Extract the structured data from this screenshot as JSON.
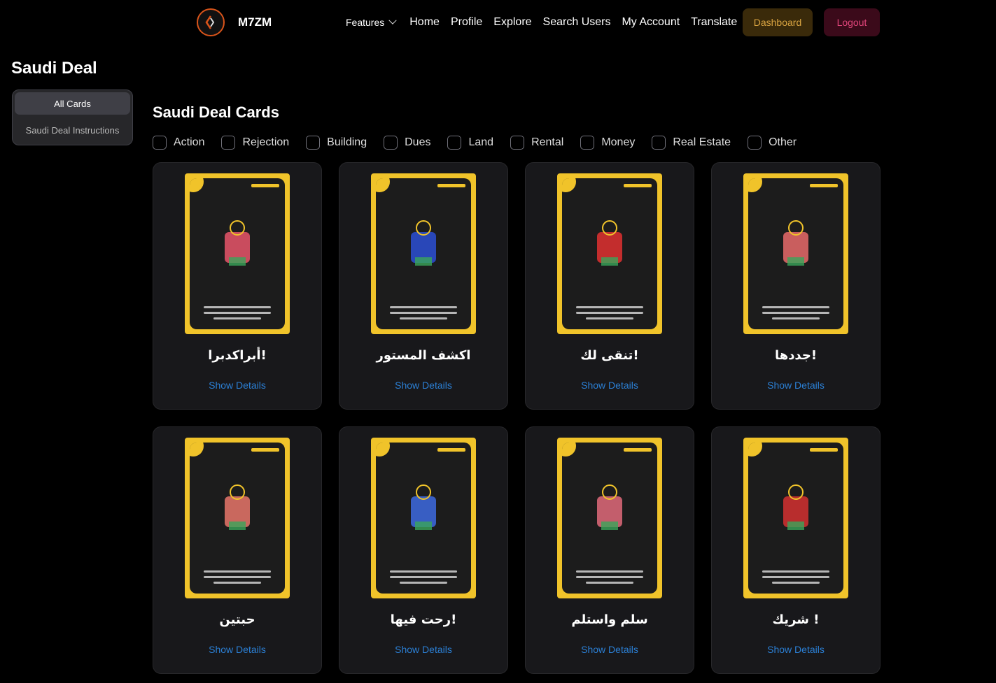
{
  "header": {
    "brand": "M7ZM",
    "nav": [
      {
        "label": "Features"
      },
      {
        "label": "Home"
      },
      {
        "label": "Profile"
      },
      {
        "label": "Explore"
      },
      {
        "label": "Search Users"
      },
      {
        "label": "My Account"
      },
      {
        "label": "Translate"
      }
    ],
    "dashboard": "Dashboard",
    "logout": "Logout"
  },
  "page_title": "Saudi Deal",
  "sidebar": {
    "items": [
      {
        "label": "All Cards",
        "active": true
      },
      {
        "label": "Saudi Deal Instructions",
        "active": false
      }
    ]
  },
  "section_title": "Saudi Deal Cards",
  "filters": [
    "Action",
    "Rejection",
    "Building",
    "Dues",
    "Land",
    "Rental",
    "Money",
    "Real Estate",
    "Other"
  ],
  "cards": [
    {
      "name": "أبراكدبرا!",
      "link": "Show Details",
      "art_color": "#e8556a"
    },
    {
      "name": "اكشف المستور",
      "link": "Show Details",
      "art_color": "#2b4fd4"
    },
    {
      "name": "تنقى لك!",
      "link": "Show Details",
      "art_color": "#e03030"
    },
    {
      "name": "جددها!",
      "link": "Show Details",
      "art_color": "#e86a6a"
    },
    {
      "name": "حبتين",
      "link": "Show Details",
      "art_color": "#e8756a"
    },
    {
      "name": "رحت فيها!",
      "link": "Show Details",
      "art_color": "#3d6ae0"
    },
    {
      "name": "سلم واستلم",
      "link": "Show Details",
      "art_color": "#e06a7a"
    },
    {
      "name": "شريك !",
      "link": "Show Details",
      "art_color": "#d43030"
    }
  ],
  "colors": {
    "accent_link": "#2b7fd4",
    "dashboard_text": "#d9a441",
    "logout_text": "#e0457a",
    "card_frame": "#f0c32a"
  }
}
